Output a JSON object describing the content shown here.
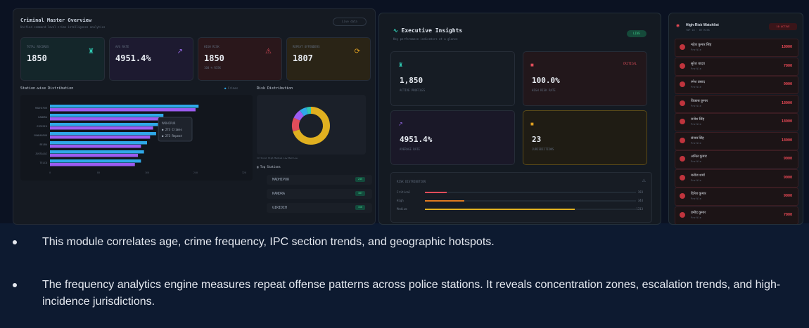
{
  "left_panel": {
    "title": "Criminal Master Overview",
    "subtitle": "Unified command-level crime intelligence analytics",
    "pill": "Live data",
    "kpis": [
      {
        "label": "TOTAL RECORDS",
        "value": "1850",
        "sub": "",
        "icon": "person-icon",
        "color": "#2fc7b0"
      },
      {
        "label": "AVG RATE",
        "value": "4951.4%",
        "sub": "",
        "icon": "trend-icon",
        "color": "#9c6cf0"
      },
      {
        "label": "HIGH RISK",
        "value": "1850",
        "sub": "100 % RISK",
        "icon": "warning-icon",
        "color": "#e04d5a"
      },
      {
        "label": "REPEAT OFFENDERS",
        "value": "1807",
        "sub": "",
        "icon": "repeat-icon",
        "color": "#e0a020"
      }
    ],
    "chart_title": "Station-wise Distribution",
    "chart_legend": "Crimes",
    "risk_title": "Risk Distribution",
    "donut_legend": "Critical  High  Medium  Low-Med  Low",
    "top_title": "Top Stations",
    "top_stations": [
      {
        "name": "MADHIPUR",
        "badge": "245"
      },
      {
        "name": "KANDRA",
        "badge": "187"
      },
      {
        "name": "GIRIDIH",
        "badge": "156"
      }
    ]
  },
  "chart_data": {
    "type": "bar",
    "orientation": "horizontal",
    "categories": [
      "MADHIPUR",
      "KANDRA",
      "GIRIDIH",
      "SUNDARPUR",
      "BELBA",
      "JUGSALAI",
      "TELCO"
    ],
    "series": [
      {
        "name": "Crimes",
        "values": [
          245,
          187,
          180,
          175,
          160,
          155,
          150
        ],
        "color": "#2fa8e8"
      },
      {
        "name": "Repeat",
        "values": [
          240,
          180,
          170,
          165,
          150,
          145,
          140
        ],
        "color": "#9c5cf0"
      }
    ],
    "xlim": [
      0,
      320
    ],
    "tooltip": {
      "title": "MADHIPUR",
      "lines": [
        "273 Crimes",
        "273 Repeat"
      ]
    },
    "donut": {
      "type": "pie",
      "values": [
        70,
        12,
        8,
        6,
        4
      ],
      "labels": [
        "Critical",
        "High",
        "Medium",
        "Low-Med",
        "Low"
      ],
      "colors": [
        "#e0b020",
        "#e04d5a",
        "#9c5cf0",
        "#2fa8e8",
        "#2fc7b0"
      ]
    }
  },
  "mid_panel": {
    "title": "Executive Insights",
    "subtitle": "Key performance indicators at a glance",
    "live": "LIVE",
    "cards": [
      {
        "value": "1,850",
        "label": "ACTIVE PROFILES",
        "tag": "",
        "icon": "person-icon",
        "color": "#2fc7b0"
      },
      {
        "value": "100.0%",
        "label": "HIGH RISK RATE",
        "tag": "CRITICAL",
        "icon": "alert-icon",
        "color": "#e04d5a"
      },
      {
        "value": "4951.4%",
        "label": "AVERAGE RATE",
        "tag": "",
        "icon": "trend-icon",
        "color": "#9c6cf0"
      },
      {
        "value": "23",
        "label": "JURISDICTIONS",
        "tag": "",
        "icon": "map-icon",
        "color": "#e0a020"
      }
    ],
    "risk_bars_title": "RISK DISTRIBUTION",
    "risk_bars": [
      {
        "name": "Critical",
        "value": 193,
        "max": 1850,
        "color": "#e04d5a"
      },
      {
        "name": "High",
        "value": 344,
        "max": 1850,
        "color": "#e07a20"
      },
      {
        "name": "Medium",
        "value": 1313,
        "max": 1850,
        "color": "#e0b020"
      }
    ]
  },
  "right_panel": {
    "title": "High-Risk Watchlist",
    "subtitle": "TOP 10 · BY RISK",
    "badge": "10 ACTIVE",
    "offenders": [
      {
        "name": "महेश कुमार सिंह",
        "sub": "Profile",
        "value": "18000"
      },
      {
        "name": "सुरेश यादव",
        "sub": "Profile",
        "value": "7000"
      },
      {
        "name": "रमेश प्रसाद",
        "sub": "Profile",
        "value": "9000"
      },
      {
        "name": "विकास कुमार",
        "sub": "Profile",
        "value": "18000"
      },
      {
        "name": "राजेश सिंह",
        "sub": "Profile",
        "value": "18000"
      },
      {
        "name": "संजय सिंह",
        "sub": "Profile",
        "value": "18000"
      },
      {
        "name": "अनिल कुमार",
        "sub": "Profile",
        "value": "9000"
      },
      {
        "name": "मनोज शर्मा",
        "sub": "Profile",
        "value": "9000"
      },
      {
        "name": "दिनेश कुमार",
        "sub": "Profile",
        "value": "9000"
      },
      {
        "name": "प्रमोद कुमार",
        "sub": "Profile",
        "value": "7000"
      }
    ]
  },
  "bullets": [
    "This module correlates age, crime frequency, IPC section trends, and geographic hotspots.",
    "The frequency analytics engine measures repeat offense patterns across police stations. It reveals concentration zones, escalation trends, and high-incidence jurisdictions."
  ]
}
